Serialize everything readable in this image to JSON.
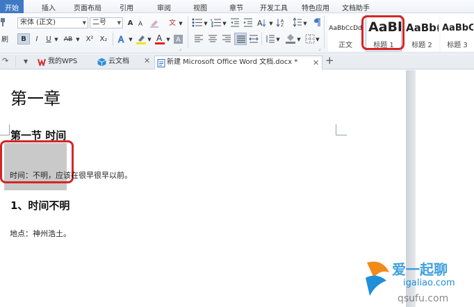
{
  "menu": {
    "items": [
      {
        "label": "开始",
        "active": true
      },
      {
        "label": "插入"
      },
      {
        "label": "页面布局"
      },
      {
        "label": "引用"
      },
      {
        "label": "审阅"
      },
      {
        "label": "视图"
      },
      {
        "label": "章节"
      },
      {
        "label": "开发工具"
      },
      {
        "label": "特色应用"
      },
      {
        "label": "文档助手"
      }
    ]
  },
  "ribbon": {
    "font_name": "宋体 (正文)",
    "font_size": "二号",
    "format_painter_label": "刷",
    "bold": "B",
    "italic": "I",
    "underline": "U",
    "strike": "AB",
    "superscript": "X²",
    "subscript": "X₂",
    "grow_font": "A",
    "shrink_font": "A",
    "font_color_glyph": "A",
    "phonetic_glyph": "文",
    "styles": [
      {
        "preview": "AaBbCcDd",
        "name": "正文"
      },
      {
        "preview": "AaBb",
        "name": "标题 1",
        "selected": true
      },
      {
        "preview": "AaBb(",
        "name": "标题 2"
      },
      {
        "preview": "AaBbC",
        "name": "标题 3"
      }
    ],
    "accent_color": "#3f79c6",
    "highlight_color": "#d32626"
  },
  "tabs": {
    "items": [
      {
        "label": "我的WPS",
        "icon": "wps-logo-icon"
      },
      {
        "label": "云文档",
        "icon": "cloud-doc-icon"
      },
      {
        "label": "新建 Microsoft Office Word 文档.docx *",
        "icon": "word-doc-icon",
        "active": true
      }
    ],
    "add_label": "+"
  },
  "document": {
    "chapter": "第一章",
    "section": "第一节  时间",
    "body_1": "时间：不明，应该在很早很早以前。",
    "subsection": "1、时间不明",
    "body_2": "地点：神州浩土。"
  },
  "watermark": {
    "brand": "爱一起聊",
    "url_1": "igaliao.com",
    "url_2": "qsufu.com",
    "color": "#1e8fd8"
  }
}
